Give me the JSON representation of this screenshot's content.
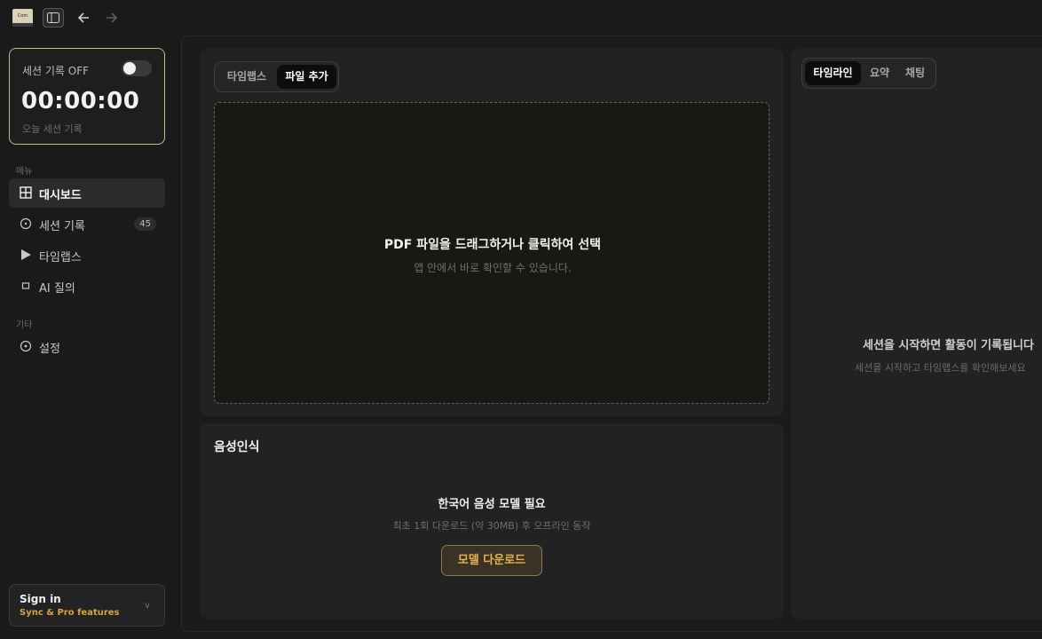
{
  "topbar": {
    "app_icon_text": "Com",
    "icons": {
      "sidebar": "sidebar-panel-icon",
      "back": "arrow-left-icon",
      "forward": "arrow-right-icon"
    }
  },
  "session": {
    "label": "세션 기록 OFF",
    "time": "00:00:00",
    "sub": "오늘 세션 기록",
    "toggle_on": false
  },
  "sidebar": {
    "menu_label": "메뉴",
    "items": [
      {
        "label": "대시보드",
        "icon": "grid-icon",
        "active": true
      },
      {
        "label": "세션 기록",
        "icon": "clock-icon",
        "badge": "45"
      },
      {
        "label": "타임랩스",
        "icon": "play-icon"
      },
      {
        "label": "AI 질의",
        "icon": "chat-icon"
      }
    ],
    "other_label": "기타",
    "other_items": [
      {
        "label": "설정",
        "icon": "gear-icon"
      }
    ]
  },
  "signin": {
    "title": "Sign in",
    "sub": "Sync & Pro features",
    "chevron": "v"
  },
  "upload_panel": {
    "tabs": [
      "타임랩스",
      "파일 추가"
    ],
    "active_tab": 1,
    "drop_title": "PDF 파일을 드래그하거나 클릭하여 선택",
    "drop_sub": "앱 안에서 바로 확인할 수 있습니다."
  },
  "voice_panel": {
    "title": "음성인식",
    "need": "한국어 음성 모델 필요",
    "sub": "최초 1회 다운로드 (약 30MB) 후 오프라인 동작",
    "button": "모델 다운로드"
  },
  "right_panel": {
    "tabs": [
      "타임라인",
      "요약",
      "채팅"
    ],
    "active_tab": 0,
    "empty_title": "세션을 시작하면 활동이 기록됩니다",
    "empty_sub": "세션을 시작하고 타임랩스를 확인해보세요"
  },
  "colors": {
    "accent": "#d6a441",
    "card_border": "#c9b98a",
    "background": "#1a1a1a"
  }
}
